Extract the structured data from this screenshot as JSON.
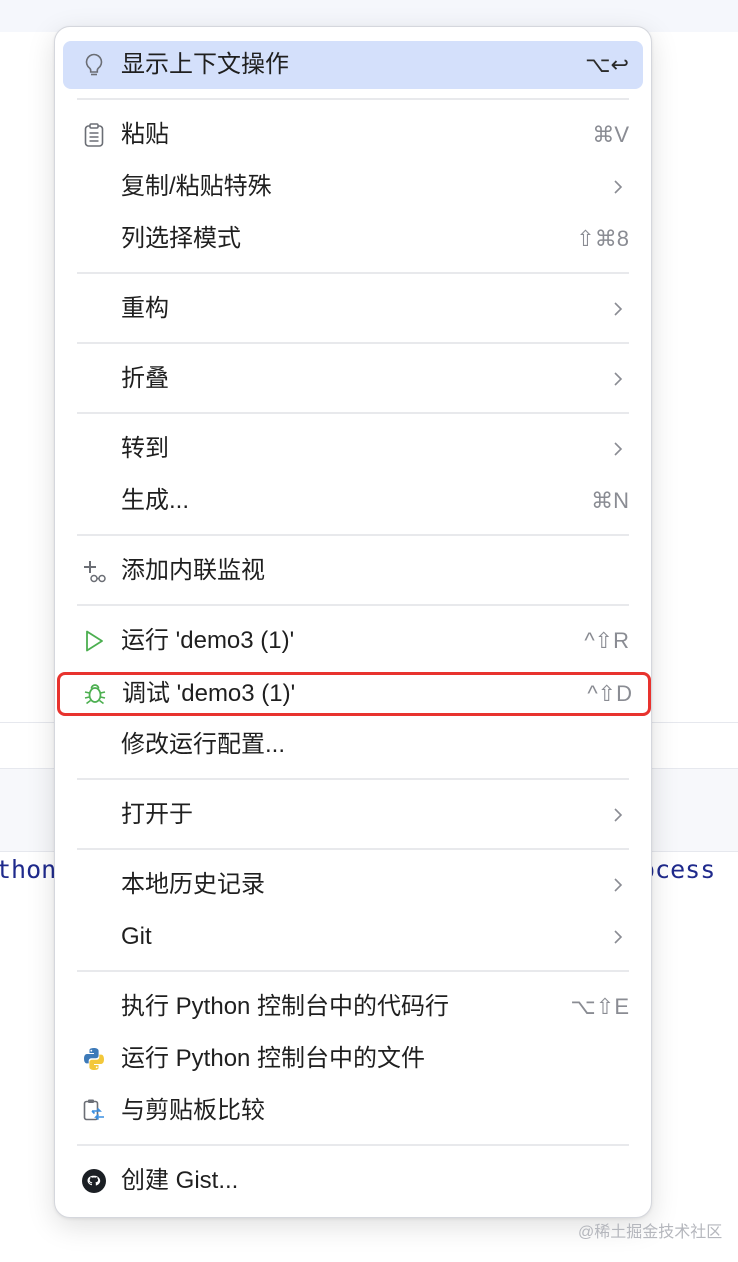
{
  "background": {
    "code_left": "thon",
    "code_right": "ocess"
  },
  "menu": {
    "items": [
      {
        "label": "显示上下文操作",
        "shortcut": "⌥↩",
        "icon": "lightbulb-icon"
      },
      {
        "label": "粘贴",
        "shortcut": "⌘V",
        "icon": "clipboard-icon"
      },
      {
        "label": "复制/粘贴特殊",
        "submenu": true
      },
      {
        "label": "列选择模式",
        "shortcut": "⇧⌘8"
      },
      {
        "label": "重构",
        "submenu": true
      },
      {
        "label": "折叠",
        "submenu": true
      },
      {
        "label": "转到",
        "submenu": true
      },
      {
        "label": "生成...",
        "shortcut": "⌘N"
      },
      {
        "label": "添加内联监视",
        "icon": "add-watch-icon"
      },
      {
        "label": "运行 'demo3 (1)'",
        "shortcut": "^⇧R",
        "icon": "run-icon"
      },
      {
        "label": "调试 'demo3 (1)'",
        "shortcut": "^⇧D",
        "icon": "bug-icon"
      },
      {
        "label": "修改运行配置..."
      },
      {
        "label": "打开于",
        "submenu": true
      },
      {
        "label": "本地历史记录",
        "submenu": true
      },
      {
        "label": "Git",
        "submenu": true
      },
      {
        "label": "执行 Python 控制台中的代码行",
        "shortcut": "⌥⇧E"
      },
      {
        "label": "运行 Python 控制台中的文件",
        "icon": "python-icon"
      },
      {
        "label": "与剪贴板比较",
        "icon": "compare-clipboard-icon"
      },
      {
        "label": "创建 Gist...",
        "icon": "github-icon"
      }
    ]
  },
  "watermark": "@稀土掘金技术社区",
  "colors": {
    "highlight": "#d4e0fb",
    "red_outline": "#e8332e",
    "run_green": "#4caf50",
    "python_blue": "#3d7ab8",
    "python_yellow": "#f3c83a"
  }
}
